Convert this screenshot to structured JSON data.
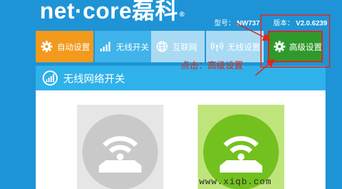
{
  "brand": {
    "logo_text": "net·core",
    "logo_cn": "磊科",
    "reg": "®"
  },
  "device": {
    "model_label": "型号：",
    "model_value": "NW737",
    "version_label": "版本：",
    "version_value": "V2.0.6239"
  },
  "tabs": [
    {
      "label": "自动设置",
      "icon": "gear-icon"
    },
    {
      "label": "无线开关",
      "icon": "signal-bars-icon"
    },
    {
      "label": "互联网",
      "icon": "globe-icon"
    },
    {
      "label": "无线设置",
      "icon": "wifi-antenna-icon"
    },
    {
      "label": "高级设置",
      "icon": "gear-icon"
    }
  ],
  "section": {
    "title": "无线网络开关",
    "icon": "wifi-icon"
  },
  "toggles": [
    {
      "state": "off",
      "color": "#c9c9c9"
    },
    {
      "state": "on",
      "color": "#73c11e"
    }
  ],
  "annotation": "点击：高级设置",
  "watermark": "www.xiqb.com",
  "colors": {
    "background": "#1e94d6",
    "tab_auto": "#f29a1e",
    "tab_active": "#3fb3ea",
    "tab_inactive": "#a9daf3",
    "tab_advanced": "#2f9a2b",
    "highlight": "#e0261a"
  }
}
